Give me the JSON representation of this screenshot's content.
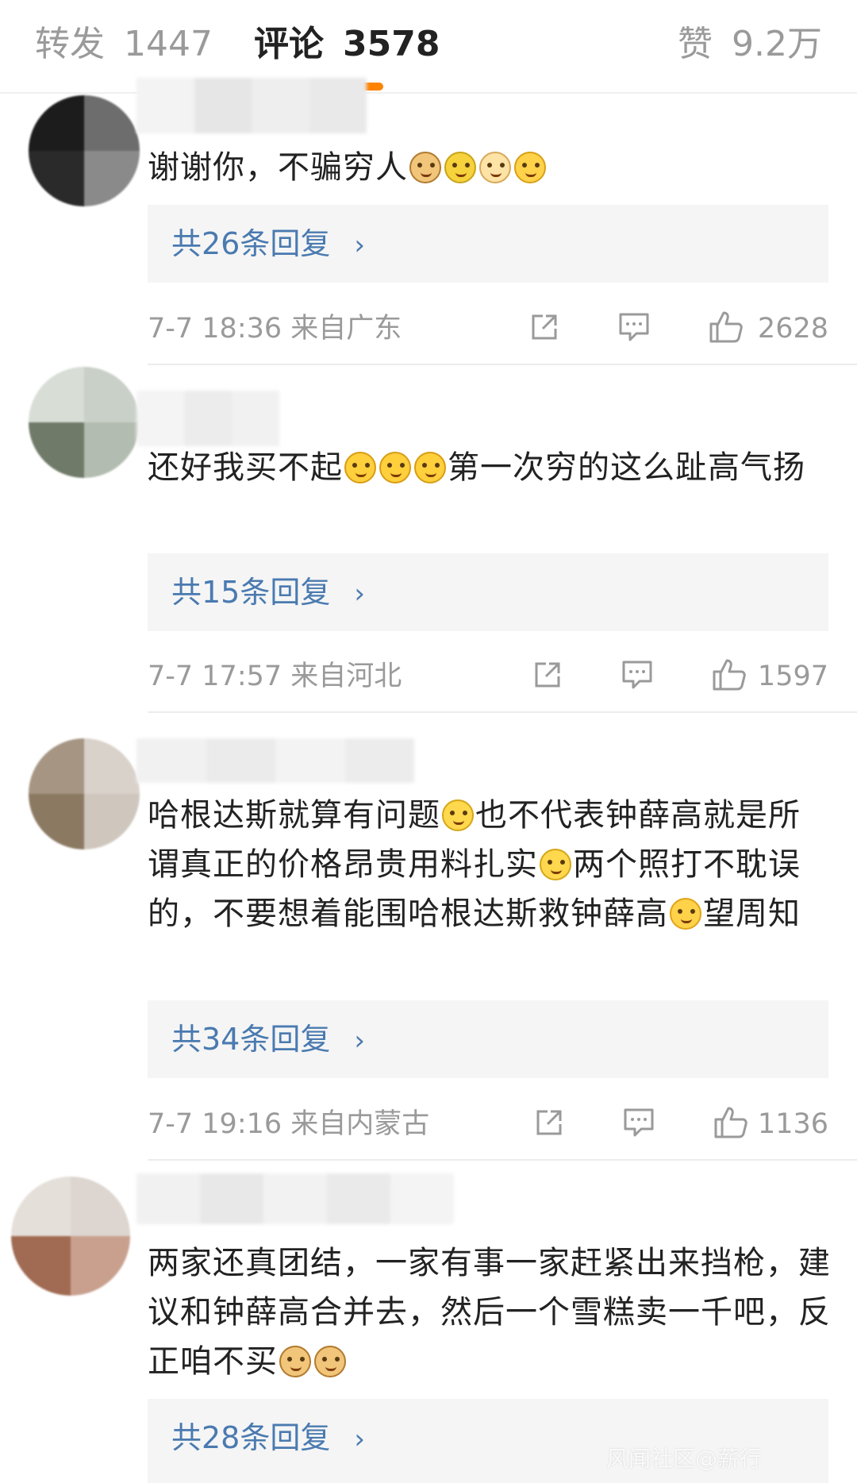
{
  "tabs": {
    "repost": {
      "label": "转发",
      "count": "1447"
    },
    "comments": {
      "label": "评论",
      "count": "3578"
    },
    "likes": {
      "label": "赞",
      "count": "9.2万"
    }
  },
  "comments": [
    {
      "text_parts": [
        "谢谢你，不骗穷人"
      ],
      "emojis": [
        "doge",
        "lemon",
        "sad",
        "cry"
      ],
      "reply_label": "共26条回复",
      "time": "7-7  18:36  来自广东",
      "likes": "2628"
    },
    {
      "text_parts": [
        "还好我买不起",
        "第一次穷的这么趾高气扬"
      ],
      "emojis": [
        "laughcry",
        "laughcry",
        "laughcry"
      ],
      "reply_label": "共15条回复",
      "time": "7-7  17:57  来自河北",
      "likes": "1597"
    },
    {
      "text_parts": [
        "哈根达斯就算有问题",
        "也不代表钟薛高就是所谓真正的价格昂贵用料扎实",
        "两个照打不耽误的，不要想着能围哈根达斯救钟薛高",
        "望周知"
      ],
      "emojis": [
        "shrug",
        "shrug",
        "smile"
      ],
      "reply_label": "共34条回复",
      "time": "7-7  19:16  来自内蒙古",
      "likes": "1136"
    },
    {
      "text_parts": [
        "两家还真团结，一家有事一家赶紧出来挡枪，建议和钟薛高合并去，然后一个雪糕卖一千吧，反正咱不买"
      ],
      "emojis": [
        "doge",
        "doge"
      ],
      "reply_label": "共28条回复"
    }
  ],
  "ui": {
    "reply_chevron": "›",
    "accent": "#ff8200",
    "link_color": "#4a7ab0"
  },
  "watermark": "风闻社区@薪行"
}
